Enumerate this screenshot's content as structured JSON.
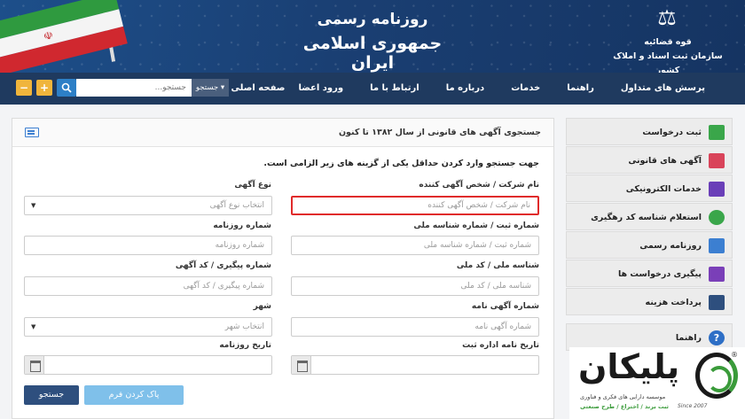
{
  "header": {
    "title_line1": "روزنامه رسمی",
    "title_line2": "جمهوری اسلامی ایران",
    "org_line1": "قوه قضائیه",
    "org_line2": "سازمان ثبت اسناد و املاک کشور",
    "flag_emblem": "☫"
  },
  "nav": {
    "items": [
      "صفحه اصلی",
      "ورود اعضا",
      "ارتباط با ما",
      "درباره ما",
      "خدمات",
      "راهنما",
      "پرسش های متداول"
    ]
  },
  "search": {
    "dropdown_label": "جستجو ▾",
    "placeholder": "جستجو...",
    "search_icon": "magnifier-icon",
    "zoom_in": "+",
    "zoom_out": "−"
  },
  "panel": {
    "title": "جستجوی آگهی های قانونی از سال ۱۳۸۲ تا کنون",
    "hint": "جهت جستجو وارد کردن حداقل یکی از گزینه های زیر الزامی است."
  },
  "form": {
    "company_label": "نام شرکت / شخص آگهی کننده",
    "company_placeholder": "نام شرکت / شخص آگهی کننده",
    "ad_type_label": "نوع آگهی",
    "ad_type_selected": "انتخاب نوع آگهی",
    "reg_label": "شماره ثبت / شماره شناسه ملی",
    "reg_placeholder": "شماره ثبت / شماره شناسه ملی",
    "newspaper_label": "شماره روزنامه",
    "newspaper_placeholder": "شماره روزنامه",
    "national_label": "شناسه ملی / کد ملی",
    "national_placeholder": "شناسه ملی / کد ملی",
    "tracking_label": "شماره پیگیری / کد آگهی",
    "tracking_placeholder": "شماره پیگیری / کد آگهی",
    "ad_no_label": "شماره آگهی نامه",
    "ad_no_placeholder": "شماره آگهی نامه",
    "city_label": "شهر",
    "city_selected": "انتخاب شهر",
    "letter_date_label": "تاریخ نامه اداره ثبت",
    "newspaper_date_label": "تاریخ روزنامه",
    "search_button": "جستجو",
    "clear_button": "پاک کردن فرم"
  },
  "sidebar": {
    "items": [
      {
        "label": "ثبت درخواست",
        "icon": "register-icon",
        "color": "#3aa64a"
      },
      {
        "label": "آگهی های قانونی",
        "icon": "legal-ads-icon",
        "color": "#d9445a"
      },
      {
        "label": "خدمات الکترونیکی",
        "icon": "monitor-icon",
        "color": "#6a3fb8"
      },
      {
        "label": "استعلام شناسه کد رهگیری",
        "icon": "inquiry-icon",
        "color": "#3aa64a"
      },
      {
        "label": "روزنامه رسمی",
        "icon": "newspaper-icon",
        "color": "#3c7fd1"
      },
      {
        "label": "پیگیری درخواست ها",
        "icon": "tracking-icon",
        "color": "#7a3fb8"
      },
      {
        "label": "پرداخت هزینه",
        "icon": "payment-icon",
        "color": "#2e4f7e"
      },
      {
        "label": "راهنما",
        "icon": "help-icon",
        "color": "#2e6fc6"
      }
    ]
  },
  "logo": {
    "word": "پلیکان",
    "line1": "موسسه دارایی های فکری و فناوری",
    "line2": "ثبت برند / اختراع / طرح صنعتی",
    "since": "Since 2007",
    "reg": "®"
  }
}
